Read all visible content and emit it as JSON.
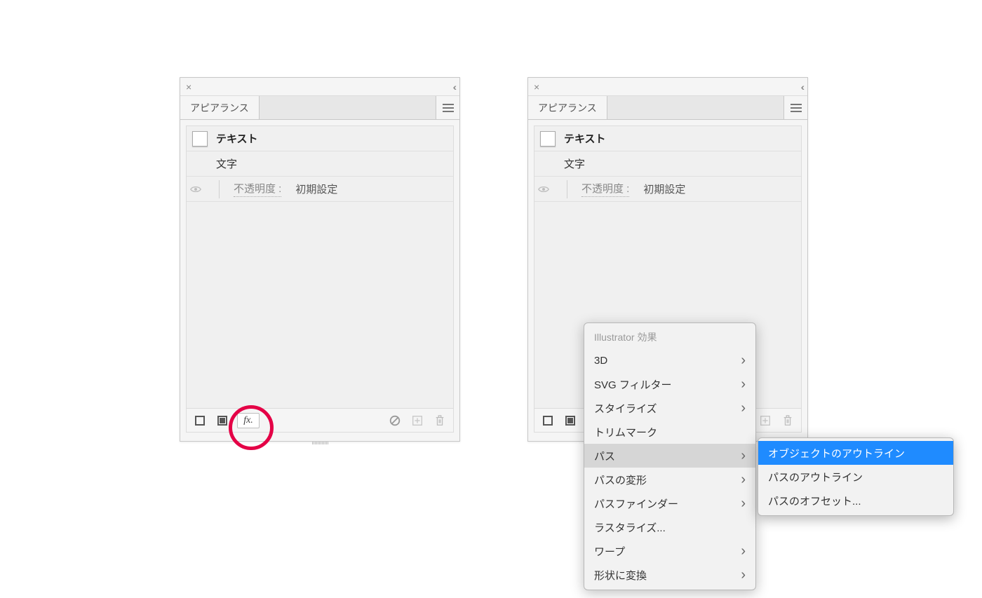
{
  "panel": {
    "tab_label": "アピアランス",
    "row_title": "テキスト",
    "row_chars": "文字",
    "opacity_label": "不透明度 :",
    "opacity_value": "初期設定",
    "fx_label": "fx."
  },
  "menu": {
    "header": "Illustrator 効果",
    "items": [
      {
        "label": "3D",
        "has_children": true,
        "hover": false
      },
      {
        "label": "SVG フィルター",
        "has_children": true,
        "hover": false
      },
      {
        "label": "スタイライズ",
        "has_children": true,
        "hover": false
      },
      {
        "label": "トリムマーク",
        "has_children": false,
        "hover": false
      },
      {
        "label": "パス",
        "has_children": true,
        "hover": true
      },
      {
        "label": "パスの変形",
        "has_children": true,
        "hover": false
      },
      {
        "label": "パスファインダー",
        "has_children": true,
        "hover": false
      },
      {
        "label": "ラスタライズ...",
        "has_children": false,
        "hover": false
      },
      {
        "label": "ワープ",
        "has_children": true,
        "hover": false
      },
      {
        "label": "形状に変換",
        "has_children": true,
        "hover": false
      }
    ]
  },
  "submenu": {
    "items": [
      {
        "label": "オブジェクトのアウトライン",
        "selected": true
      },
      {
        "label": "パスのアウトライン",
        "selected": false
      },
      {
        "label": "パスのオフセット...",
        "selected": false
      }
    ]
  }
}
